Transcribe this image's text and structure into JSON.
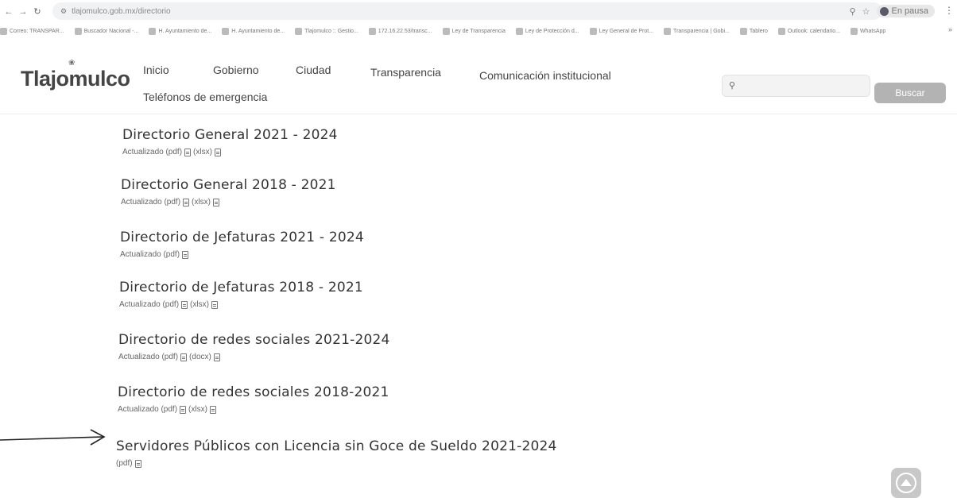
{
  "browser": {
    "url": "tlajomulco.gob.mx/directorio",
    "profile_label": "En pausa",
    "bookmarks": [
      "Correo: TRANSPAR...",
      "Buscador Nacional -...",
      "H. Ayuntamiento de...",
      "H. Ayuntamiento de...",
      "Tlajomulco :: Gestio...",
      "172.16.22.53/transc...",
      "Ley de Transparencia",
      "Ley de Protección d...",
      "Ley General de Prot...",
      "Transparencia | Gobi...",
      "Tablero",
      "Outlook: calendario...",
      "WhatsApp"
    ]
  },
  "header": {
    "logo": "Tlajomulco",
    "nav": [
      "Inicio",
      "Gobierno",
      "Ciudad",
      "Transparencia",
      "Comunicación institucional",
      "Teléfonos de emergencia"
    ],
    "search_placeholder": "",
    "search_button": "Buscar"
  },
  "entries": [
    {
      "title": "Directorio General 2021 - 2024",
      "prefix": "Actualizado (pdf)",
      "extra": "(xlsx)"
    },
    {
      "title": "Directorio General 2018 - 2021",
      "prefix": "Actualizado (pdf)",
      "extra": "(xlsx)"
    },
    {
      "title": "Directorio de Jefaturas 2021 - 2024",
      "prefix": "Actualizado (pdf)",
      "extra": ""
    },
    {
      "title": "Directorio de Jefaturas 2018 - 2021",
      "prefix": "Actualizado (pdf)",
      "extra": "(xlsx)"
    },
    {
      "title": "Directorio de redes sociales 2021-2024",
      "prefix": "Actualizado (pdf)",
      "extra": "(docx)"
    },
    {
      "title": "Directorio de redes sociales 2018-2021",
      "prefix": "Actualizado (pdf)",
      "extra": "(xlsx)"
    },
    {
      "title": "Servidores Públicos con Licencia sin Goce de Sueldo 2021-2024",
      "prefix": "(pdf)",
      "extra": ""
    }
  ],
  "icons": {
    "back": "arrow-left-icon",
    "forward": "arrow-right-icon",
    "reload": "reload-icon",
    "search": "search-icon",
    "document": "document-icon",
    "scroll_top": "scroll-top-icon",
    "annotation_arrow": "arrow-right-icon"
  }
}
